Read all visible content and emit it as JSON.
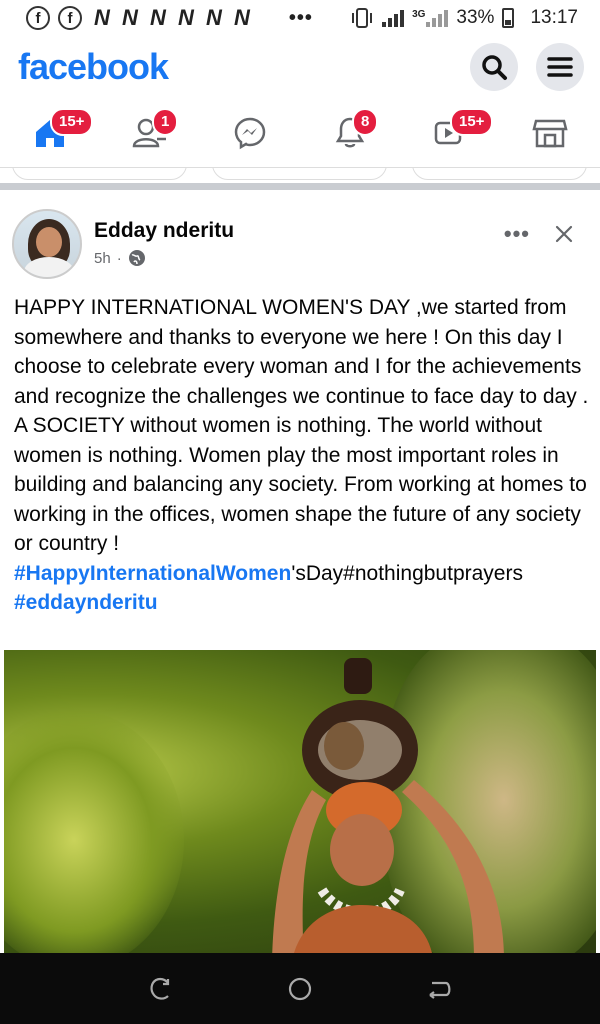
{
  "statusbar": {
    "notif_letters": "N N N N N N",
    "dots": "•••",
    "network": "3G",
    "battery": "33%",
    "time": "13:17"
  },
  "app": {
    "logo": "facebook",
    "brand_color": "#1877f2"
  },
  "nav": {
    "tabs": [
      {
        "name": "home",
        "badge": "15+"
      },
      {
        "name": "friends",
        "badge": "1"
      },
      {
        "name": "messenger",
        "badge": ""
      },
      {
        "name": "notifications",
        "badge": "8"
      },
      {
        "name": "watch",
        "badge": "15+"
      },
      {
        "name": "marketplace",
        "badge": ""
      }
    ]
  },
  "post": {
    "author": "Edday nderitu",
    "time": "5h",
    "dot": "·",
    "more": "•••",
    "text_main": "HAPPY INTERNATIONAL WOMEN'S DAY ,we started from somewhere and thanks to everyone we here ! On this day I choose to  celebrate every woman and I for the achievements and recognize the challenges we continue to face day to day . A SOCIETY without women is nothing. The world without women is nothing. Women play the most important roles in building and balancing any society. From working at homes to working in the offices, women shape the future of any society or country !",
    "hashtag1": "#HappyInternationalWomen",
    "hashtag1_rest": "'sDay#nothingbutprayers",
    "hashtag2": "#eddaynderitu"
  }
}
